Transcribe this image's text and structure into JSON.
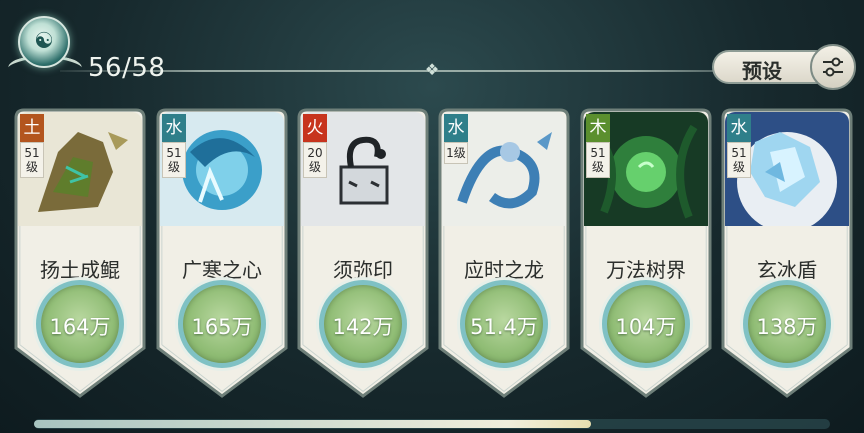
{
  "header": {
    "count": "56/58",
    "preset_label": "预设"
  },
  "cards": [
    {
      "element": "土",
      "element_color": "#b3551e",
      "level": "51级",
      "name": "扬土成鲲",
      "power": "164万",
      "art": "earth"
    },
    {
      "element": "水",
      "element_color": "#2f7f8a",
      "level": "51级",
      "name": "广寒之心",
      "power": "165万",
      "art": "water-vortex"
    },
    {
      "element": "火",
      "element_color": "#c7341e",
      "level": "20级",
      "name": "须弥印",
      "power": "142万",
      "art": "seal"
    },
    {
      "element": "水",
      "element_color": "#2f7f8a",
      "level": "1级",
      "name": "应时之龙",
      "power": "51.4万",
      "art": "dragon"
    },
    {
      "element": "木",
      "element_color": "#5b8f2e",
      "level": "51级",
      "name": "万法树界",
      "power": "104万",
      "art": "tree"
    },
    {
      "element": "水",
      "element_color": "#2f7f8a",
      "level": "51级",
      "name": "玄冰盾",
      "power": "138万",
      "art": "ice"
    }
  ],
  "scroll": {
    "progress": 0.7
  }
}
